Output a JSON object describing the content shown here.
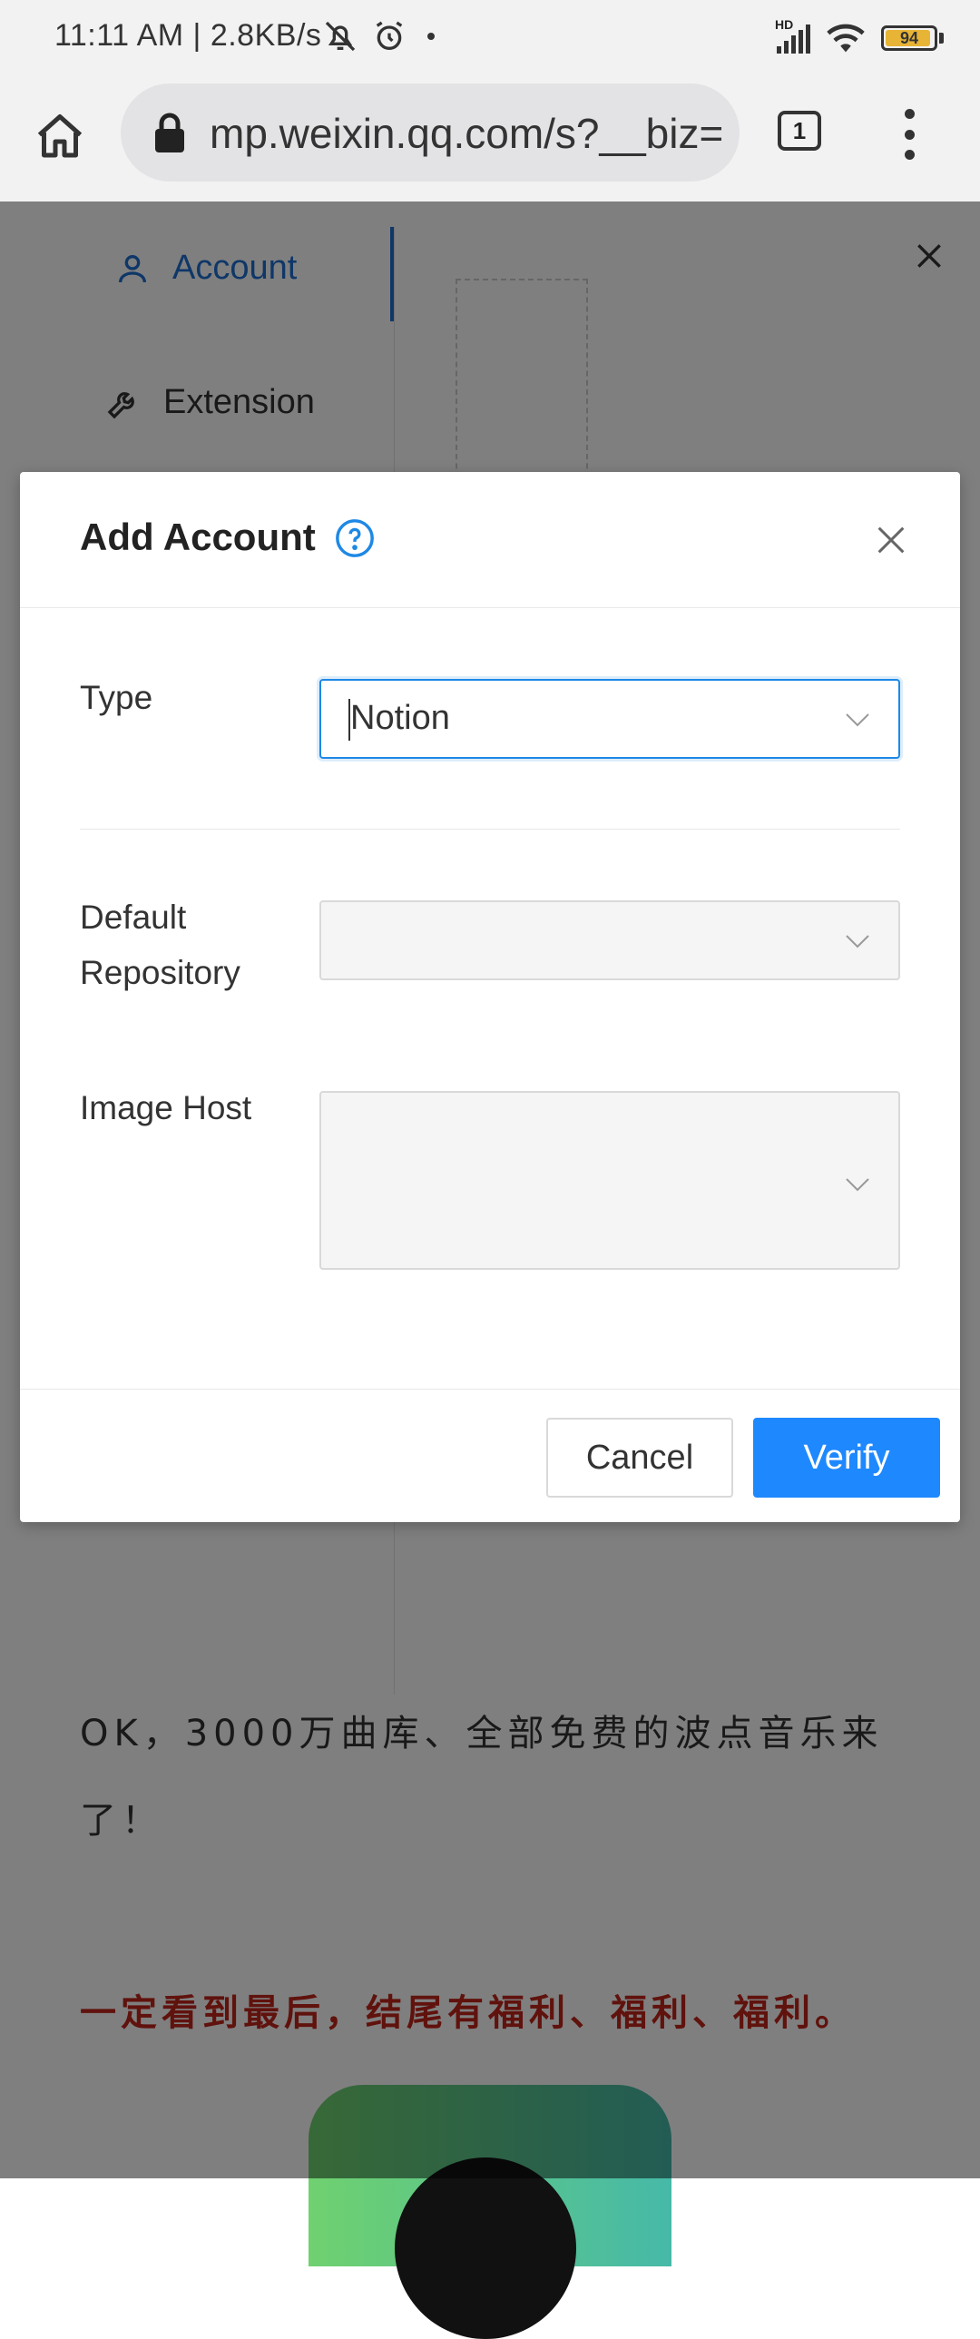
{
  "status_bar": {
    "time_speed": "11:11 AM | 2.8KB/s",
    "signal_label": "HD",
    "battery": "94",
    "battery_level": 0.94
  },
  "browser": {
    "url": "mp.weixin.qq.com/s?__biz=",
    "tab_count": "1"
  },
  "sidebar": {
    "items": [
      {
        "label": "Account",
        "active": true
      },
      {
        "label": "Extension",
        "active": false
      }
    ]
  },
  "article": {
    "paragraph1": "OK，3000万曲库、全部免费的波点音乐来了！",
    "paragraph2": "一定看到最后，结尾有福利、福利、福利。"
  },
  "modal": {
    "title": "Add Account",
    "fields": {
      "type": {
        "label": "Type",
        "value": "Notion"
      },
      "default_repository": {
        "label": "Default Repository",
        "value": ""
      },
      "image_host": {
        "label": "Image Host",
        "value": ""
      }
    },
    "cancel_label": "Cancel",
    "verify_label": "Verify"
  },
  "colors": {
    "accent": "#1e88ff",
    "active_nav": "#1e6fd0",
    "article_highlight": "#c0251b"
  }
}
